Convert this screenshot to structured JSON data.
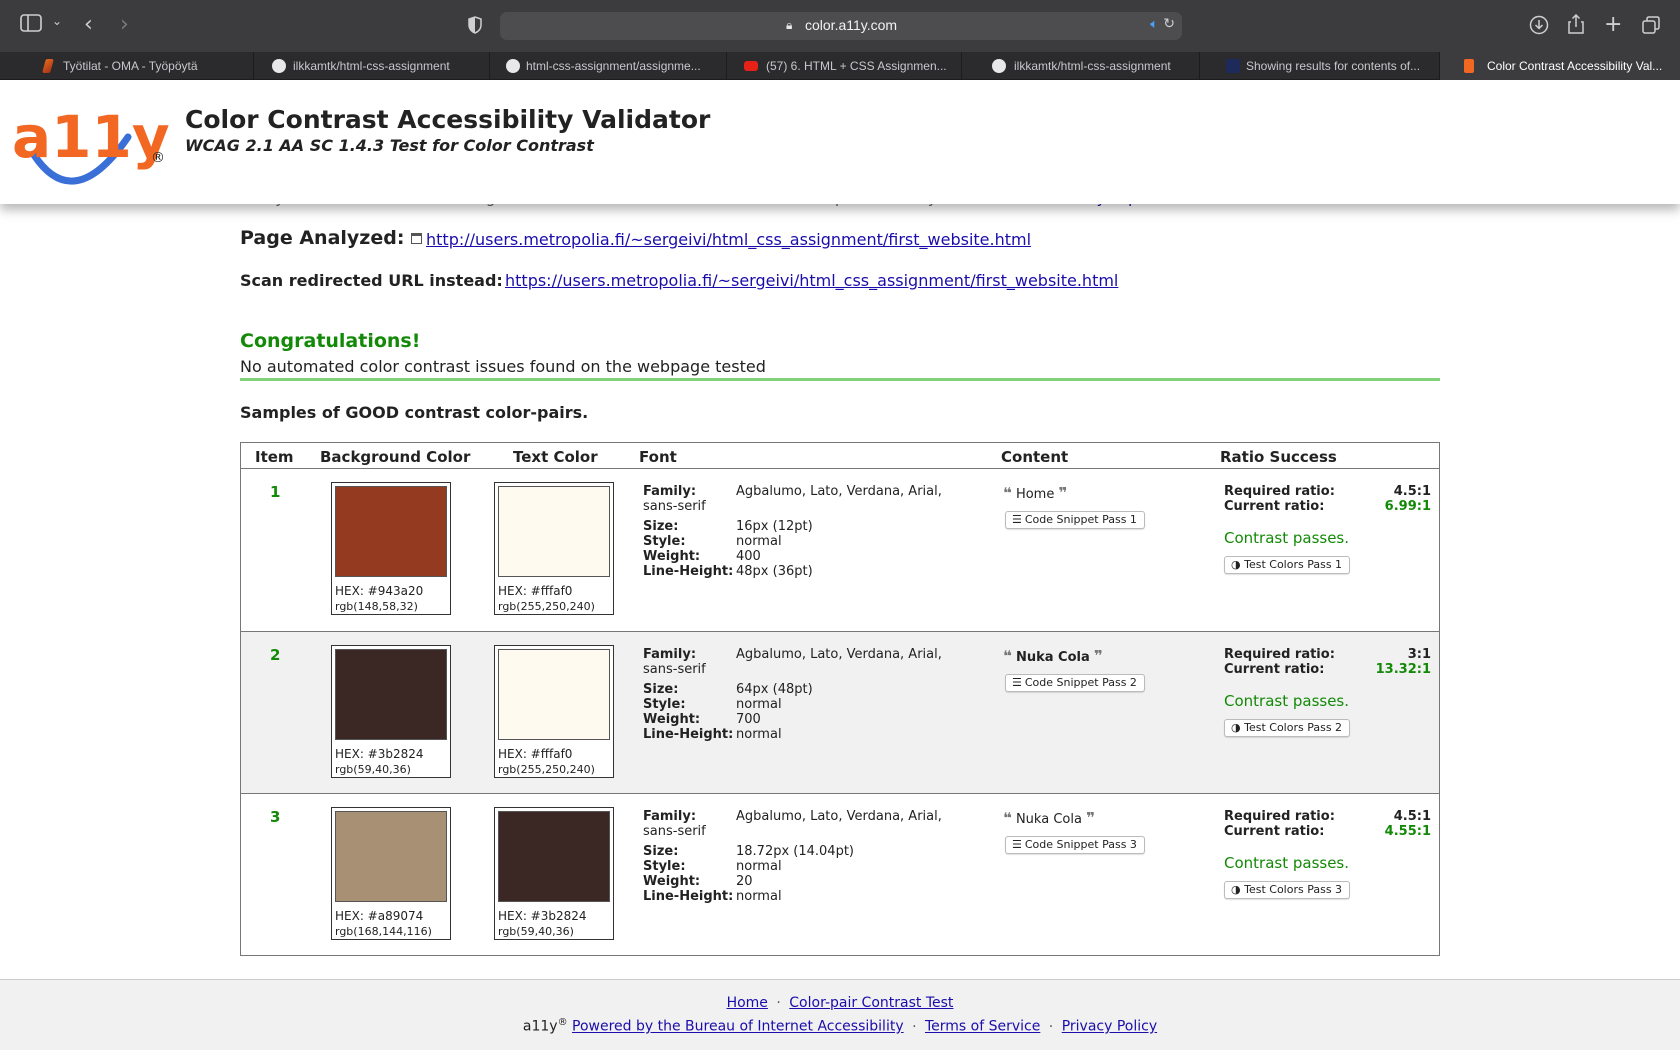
{
  "browser": {
    "url": "color.a11y.com",
    "tabs": [
      {
        "title": "Työtilat - OMA - Työpöytä",
        "active": false
      },
      {
        "title": "ilkkamtk/html-css-assignment",
        "active": false
      },
      {
        "title": "html-css-assignment/assignme...",
        "active": false
      },
      {
        "title": "(57) 6. HTML + CSS Assignmen...",
        "active": false
      },
      {
        "title": "ilkkamtk/html-css-assignment",
        "active": false
      },
      {
        "title": "Showing results for contents of...",
        "active": false
      },
      {
        "title": "Color Contrast Accessibility Val...",
        "active": true
      }
    ]
  },
  "header": {
    "logo_text": "a11y",
    "logo_mark": "®",
    "title": "Color Contrast Accessibility Validator",
    "subtitle": "WCAG 2.1 AA SC 1.4.3 Test for Color Contrast"
  },
  "cutoff": {
    "text": "that you combine contrast testing results from this website with a manual test performed by a",
    "link": "trained accessibility expert."
  },
  "analysis": {
    "page_label": "Page Analyzed:",
    "page_url": "http://users.metropolia.fi/~sergeivi/html_css_assignment/first_website.html",
    "redirect_label": "Scan redirected URL instead:",
    "redirect_url": "https://users.metropolia.fi/~sergeivi/html_css_assignment/first_website.html"
  },
  "result": {
    "heading": "Congratulations!",
    "message": "No automated color contrast issues found on the webpage tested",
    "samples_heading": "Samples of GOOD contrast color-pairs."
  },
  "table": {
    "headers": {
      "item": "Item",
      "background": "Background Color",
      "text": "Text Color",
      "font": "Font",
      "content": "Content",
      "ratio": "Ratio Success"
    },
    "labels": {
      "family": "Family:",
      "size": "Size:",
      "style": "Style:",
      "weight": "Weight:",
      "line_height": "Line-Height:",
      "required": "Required ratio:",
      "current": "Current ratio:",
      "passes": "Contrast passes."
    },
    "rows": [
      {
        "item": "1",
        "bg_hex": "HEX: #943a20",
        "bg_rgb": "rgb(148,58,32)",
        "bg_color": "#943a20",
        "fg_hex": "HEX: #fffaf0",
        "fg_rgb": "rgb(255,250,240)",
        "fg_color": "#fffaf0",
        "family": "Agbalumo, Lato, Verdana, Arial, sans-serif",
        "size": "16px (12pt)",
        "style": "normal",
        "weight": "400",
        "line_height": "48px (36pt)",
        "content": "Home",
        "content_bold": false,
        "snippet": "Code Snippet Pass 1",
        "required": "4.5:1",
        "current": "6.99:1",
        "test": "Test Colors Pass 1"
      },
      {
        "item": "2",
        "bg_hex": "HEX: #3b2824",
        "bg_rgb": "rgb(59,40,36)",
        "bg_color": "#3b2824",
        "fg_hex": "HEX: #fffaf0",
        "fg_rgb": "rgb(255,250,240)",
        "fg_color": "#fffaf0",
        "family": "Agbalumo, Lato, Verdana, Arial, sans-serif",
        "size": "64px (48pt)",
        "style": "normal",
        "weight": "700",
        "line_height": "normal",
        "content": "Nuka Cola",
        "content_bold": true,
        "snippet": "Code Snippet Pass 2",
        "required": "3:1",
        "current": "13.32:1",
        "test": "Test Colors Pass 2"
      },
      {
        "item": "3",
        "bg_hex": "HEX: #a89074",
        "bg_rgb": "rgb(168,144,116)",
        "bg_color": "#a89074",
        "fg_hex": "HEX: #3b2824",
        "fg_rgb": "rgb(59,40,36)",
        "fg_color": "#3b2824",
        "family": "Agbalumo, Lato, Verdana, Arial, sans-serif",
        "size": "18.72px (14.04pt)",
        "style": "normal",
        "weight": "20",
        "line_height": "normal",
        "content": "Nuka Cola",
        "content_bold": false,
        "snippet": "Code Snippet Pass 3",
        "required": "4.5:1",
        "current": "4.55:1",
        "test": "Test Colors Pass 3"
      }
    ]
  },
  "footer": {
    "home": "Home",
    "contrast_test": "Color-pair Contrast Test",
    "brand": "a11y",
    "brand_mark": "®",
    "powered": "Powered by the Bureau of Internet Accessibility",
    "terms": "Terms of Service",
    "privacy": "Privacy Policy",
    "separator": "·"
  },
  "colors": {
    "success_green": "#138a07",
    "link_blue": "#1a0dab",
    "logo_orange": "#f26722",
    "logo_blue": "#3a6fd8"
  }
}
